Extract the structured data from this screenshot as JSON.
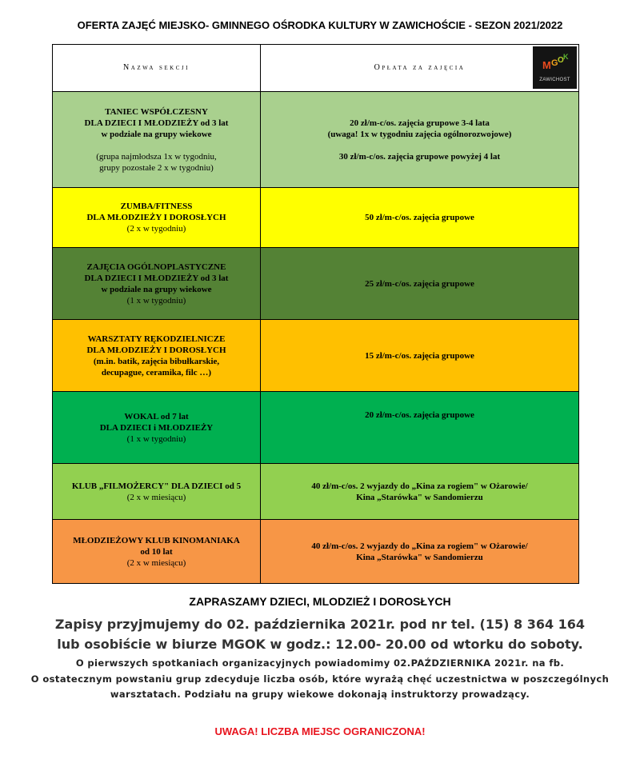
{
  "title": "OFERTA ZAJĘĆ MIEJSKO- GMINNEGO OŚRODKA KULTURY W ZAWICHOŚCIE - SEZON 2021/2022",
  "table": {
    "col1_header": "Nazwa sekcji",
    "col2_header": "Opłata za zajęcia",
    "logo": {
      "letters": "MGOK",
      "caption": "ZAWICHOST"
    },
    "rows": [
      {
        "color": "#a9d08e",
        "name": [
          "TANIEC WSPÓŁCZESNY",
          "DLA DZIECI I MŁODZIEŻY od 3 lat",
          "w podziale na grupy wiekowe"
        ],
        "name_note": [
          "(grupa najmłodsza 1x w tygodniu,",
          "grupy pozostałe 2 x w tygodniu)"
        ],
        "fee": [
          "20 zł/m-c/os. zajęcia grupowe 3-4 lata",
          "(uwaga! 1x w tygodniu zajęcia ogólnorozwojowe)"
        ],
        "fee_extra": "30 zł/m-c/os. zajęcia grupowe powyżej 4 lat"
      },
      {
        "color": "#ffff00",
        "name": [
          "ZUMBA/FITNESS",
          "DLA MŁODZIEŻY I DOROSŁYCH"
        ],
        "name_note": [
          "(2 x w tygodniu)"
        ],
        "fee": [
          "50 zł/m-c/os.  zajęcia grupowe"
        ]
      },
      {
        "color": "#548235",
        "name": [
          "ZAJĘCIA OGÓLNOPLASTYCZNE",
          "DLA DZIECI I MŁODZIEŻY od 3 lat",
          "w podziale na grupy wiekowe"
        ],
        "name_note": [
          "(1 x w tygodniu)"
        ],
        "fee": [
          "25 zł/m-c/os. zajęcia grupowe"
        ]
      },
      {
        "color": "#ffc000",
        "name": [
          "WARSZTATY RĘKODZIELNICZE",
          "DLA MŁODZIEŻY I DOROSŁYCH",
          "(m.in. batik, zajęcia bibułkarskie,",
          "decupague, ceramika, filc …)"
        ],
        "name_note": [],
        "fee": [
          "15 zł/m-c/os.  zajęcia grupowe"
        ]
      },
      {
        "color": "#00b050",
        "name": [
          "WOKAL od 7 lat",
          "DLA DZIECI i MŁODZIEŻY"
        ],
        "name_note": [
          "(1 x w tygodniu)"
        ],
        "fee": [
          "20 zł/m-c/os.  zajęcia grupowe"
        ]
      },
      {
        "color": "#92d050",
        "name": [
          "KLUB „FILMOŻERCY\" DLA DZIECI od 5"
        ],
        "name_note": [
          "(2 x w miesiącu)"
        ],
        "fee": [
          "40 zł/m-c/os.  2 wyjazdy do „Kina za rogiem\" w Ożarowie/",
          "Kina „Starówka\" w Sandomierzu"
        ]
      },
      {
        "color": "#f79646",
        "name": [
          "MŁODZIEŻOWY KLUB KINOMANIAKA",
          "od 10 lat"
        ],
        "name_note": [
          "(2 x w miesiącu)"
        ],
        "fee": [
          "40 zł/m-c/os.  2 wyjazdy do „Kina za rogiem\" w Ożarowie/",
          "Kina „Starówka\" w Sandomierzu"
        ]
      }
    ]
  },
  "footer": {
    "invite": "ZAPRASZAMY DZIECI, MLODZIEŻ I DOROSŁYCH",
    "line1": "Zapisy przyjmujemy do 02. października 2021r. pod nr tel. (15) 8 364 164",
    "line2": "lub osobiście w biurze MGOK w godz.: 12.00- 20.00 od wtorku do soboty.",
    "line3": "O pierwszych spotkaniach organizacyjnych powiadomimy 02.PAŹDZIERNIKA 2021r. na fb.",
    "line4": "O ostatecznym powstaniu grup zdecyduje liczba osób, które wyrażą chęć uczestnictwa w poszczególnych warsztatach. Podziału na grupy wiekowe dokonają instruktorzy prowadzący.",
    "warning": "UWAGA! LICZBA MIEJSC OGRANICZONA!"
  }
}
